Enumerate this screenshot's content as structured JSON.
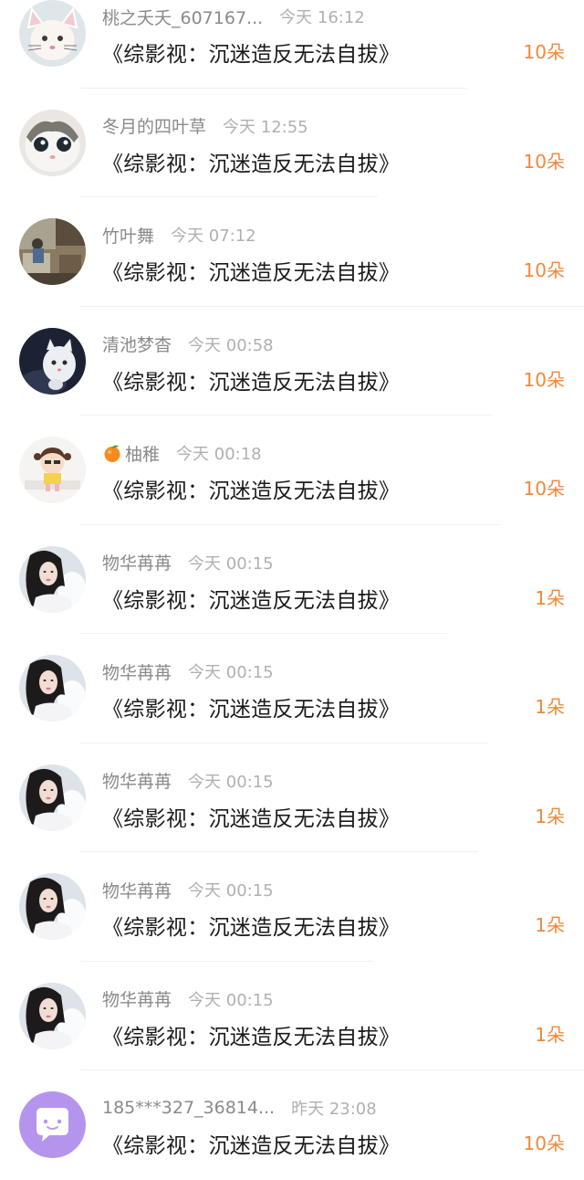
{
  "colors": {
    "amount": "#f0883a",
    "username": "#8a8a8a",
    "time": "#b0b0b0",
    "title": "#1a1a1a"
  },
  "items": [
    {
      "avatar": "cat-ears-girl",
      "username": "桃之夭夭_607167...",
      "time": "今天 16:12",
      "title": "《综影视：沉迷造反无法自拔》",
      "amount": "10朵"
    },
    {
      "avatar": "white-kitten",
      "username": "冬月的四叶草",
      "time": "今天 12:55",
      "title": "《综影视：沉迷造反无法自拔》",
      "amount": "10朵"
    },
    {
      "avatar": "room-photo",
      "username": "竹叶舞",
      "time": "今天 07:12",
      "title": "《综影视：沉迷造反无法自拔》",
      "amount": "10朵"
    },
    {
      "avatar": "night-cat",
      "username": "清池梦杳",
      "time": "今天 00:58",
      "title": "《综影视：沉迷造反无法自拔》",
      "amount": "10朵"
    },
    {
      "avatar": "cartoon-girl",
      "username": "柚稚",
      "icon": "orange-icon",
      "time": "今天 00:18",
      "title": "《综影视：沉迷造反无法自拔》",
      "amount": "10朵"
    },
    {
      "avatar": "woman-portrait",
      "username": "物华苒苒",
      "time": "今天 00:15",
      "title": "《综影视：沉迷造反无法自拔》",
      "amount": "1朵"
    },
    {
      "avatar": "woman-portrait",
      "username": "物华苒苒",
      "time": "今天 00:15",
      "title": "《综影视：沉迷造反无法自拔》",
      "amount": "1朵"
    },
    {
      "avatar": "woman-portrait",
      "username": "物华苒苒",
      "time": "今天 00:15",
      "title": "《综影视：沉迷造反无法自拔》",
      "amount": "1朵"
    },
    {
      "avatar": "woman-portrait",
      "username": "物华苒苒",
      "time": "今天 00:15",
      "title": "《综影视：沉迷造反无法自拔》",
      "amount": "1朵"
    },
    {
      "avatar": "woman-portrait",
      "username": "物华苒苒",
      "time": "今天 00:15",
      "title": "《综影视：沉迷造反无法自拔》",
      "amount": "1朵"
    },
    {
      "avatar": "chat-bubble",
      "username": "185***327_36814...",
      "time": "昨天 23:08",
      "title": "《综影视：沉迷造反无法自拔》",
      "amount": "10朵"
    }
  ]
}
